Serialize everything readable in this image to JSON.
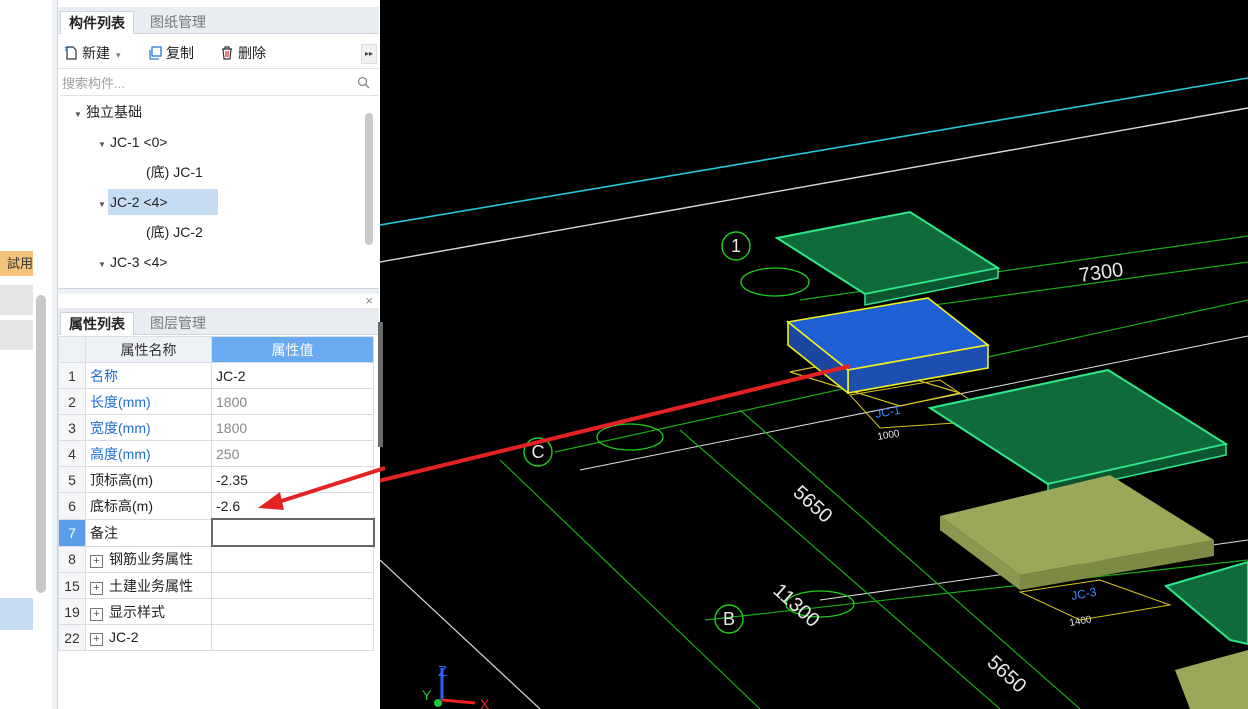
{
  "left_panel": {
    "trial_badge": "試用"
  },
  "component_panel": {
    "tabs": [
      "构件列表",
      "图纸管理"
    ],
    "close_glyph": "×",
    "toolbar": {
      "new_label": "新建",
      "copy_label": "复制",
      "delete_label": "删除",
      "more_glyph": "▸▸"
    },
    "search_placeholder": "搜索构件...",
    "tree": {
      "root": "独立基础",
      "items": [
        {
          "label": "JC-1 <0>",
          "child": "(底) JC-1"
        },
        {
          "label": "JC-2 <4>",
          "child": "(底) JC-2",
          "selected": true
        },
        {
          "label": "JC-3 <4>"
        }
      ]
    }
  },
  "property_panel": {
    "tabs": [
      "属性列表",
      "图层管理"
    ],
    "headers": {
      "name": "属性名称",
      "value": "属性值"
    },
    "rows": [
      {
        "num": "1",
        "name": "名称",
        "value": "JC-2"
      },
      {
        "num": "2",
        "name": "长度(mm)",
        "value": "1800"
      },
      {
        "num": "3",
        "name": "宽度(mm)",
        "value": "1800"
      },
      {
        "num": "4",
        "name": "高度(mm)",
        "value": "250"
      },
      {
        "num": "5",
        "name": "顶标高(m)",
        "value": "-2.35"
      },
      {
        "num": "6",
        "name": "底标高(m)",
        "value": "-2.6"
      },
      {
        "num": "7",
        "name": "备注",
        "value": ""
      },
      {
        "num": "8",
        "name": "钢筋业务属性",
        "value": ""
      },
      {
        "num": "15",
        "name": "土建业务属性",
        "value": ""
      },
      {
        "num": "19",
        "name": "显示样式",
        "value": ""
      },
      {
        "num": "22",
        "name": "JC-2",
        "value": ""
      }
    ]
  },
  "viewport": {
    "axis_labels": {
      "a1": "1",
      "c": "C",
      "b": "B"
    },
    "dimensions": {
      "d7300": "7300",
      "d5650a": "5650",
      "d11300": "11300",
      "d5650b": "5650",
      "d1000": "1000",
      "d1400": "1400"
    },
    "footing_tags": {
      "jc1": "JC-1",
      "jc3": "JC-3"
    },
    "axis_gizmo": {
      "z": "Z",
      "x": "X",
      "y": "Y"
    },
    "colors": {
      "footing_green": "#0f6b3a",
      "footing_edge": "#2ee88a",
      "selected_fill": "#1e5fd6",
      "selected_edge": "#f0f020",
      "pad_olive": "#9aa85a",
      "arrow_red": "#e52222"
    }
  }
}
